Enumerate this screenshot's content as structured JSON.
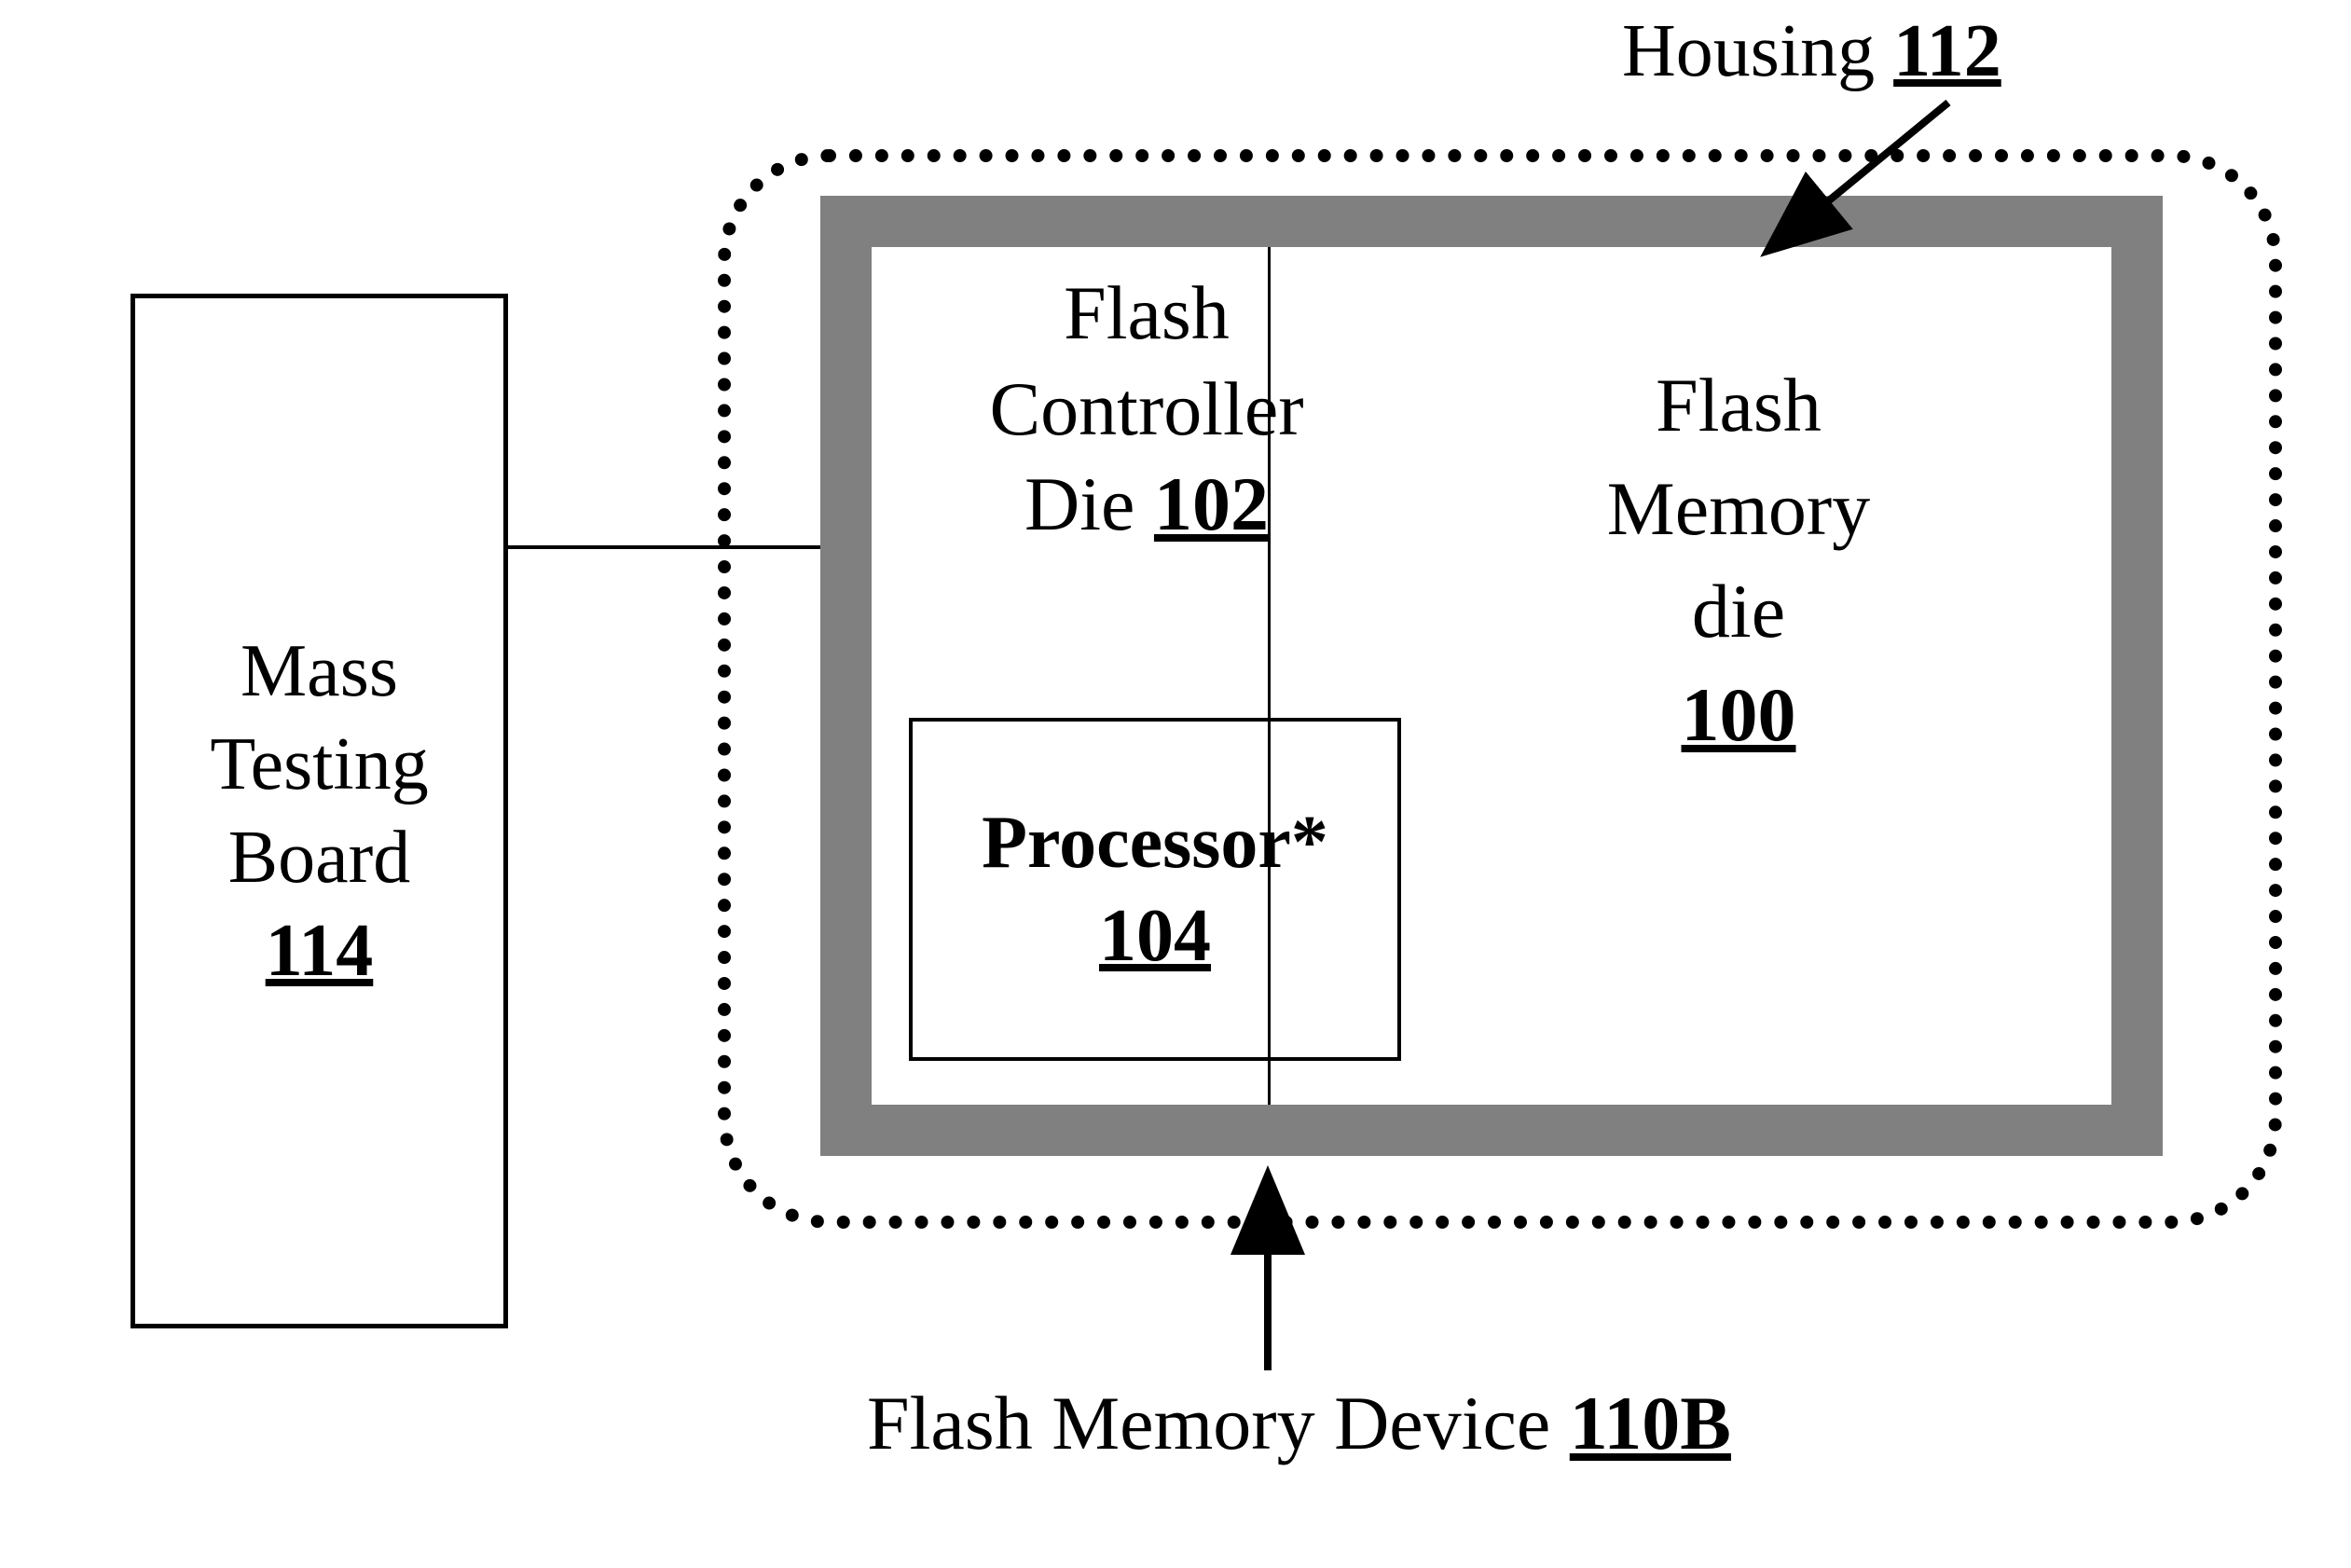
{
  "mtb": {
    "line1": "Mass",
    "line2": "Testing",
    "line3": "Board",
    "num": "114"
  },
  "housing_label": {
    "text": "Housing ",
    "num": "112"
  },
  "fcd": {
    "line1": "Flash",
    "line2": "Controller",
    "line3_prefix": "Die ",
    "num": "102"
  },
  "proc": {
    "name": "Processor*",
    "num": "104"
  },
  "fmd": {
    "line1": "Flash",
    "line2": "Memory",
    "line3": "die",
    "num": "100"
  },
  "device_label": {
    "text": "Flash Memory Device ",
    "num": "110B"
  }
}
